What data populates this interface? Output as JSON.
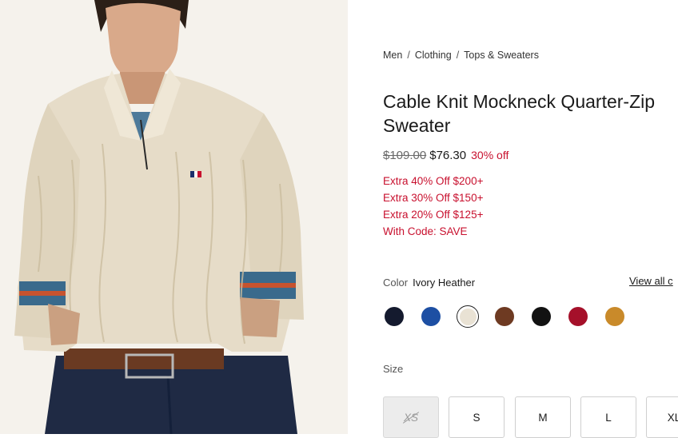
{
  "breadcrumb": [
    {
      "label": "Men"
    },
    {
      "label": "Clothing"
    },
    {
      "label": "Tops & Sweaters"
    }
  ],
  "breadcrumb_separator": "/",
  "product": {
    "title": "Cable Knit Mockneck Quarter-Zip Sweater",
    "original_price": "$109.00",
    "sale_price": "$76.30",
    "discount": "30% off",
    "promos": [
      "Extra 40% Off $200+",
      "Extra 30% Off $150+",
      "Extra 20% Off $125+",
      "With Code: SAVE"
    ]
  },
  "color": {
    "label": "Color",
    "selected": "Ivory Heather",
    "view_all": "View all c",
    "swatches": [
      {
        "name": "navy-swatch",
        "hex": "#141a2e",
        "selected": false
      },
      {
        "name": "royal-blue-swatch",
        "hex": "#1d4fa3",
        "selected": false
      },
      {
        "name": "ivory-heather-swatch",
        "hex": "#e9e2d4",
        "selected": true
      },
      {
        "name": "brown-swatch",
        "hex": "#6e3a22",
        "selected": false
      },
      {
        "name": "black-swatch",
        "hex": "#121212",
        "selected": false
      },
      {
        "name": "red-swatch",
        "hex": "#a5102a",
        "selected": false
      },
      {
        "name": "gold-swatch",
        "hex": "#c98a2a",
        "selected": false
      }
    ]
  },
  "size": {
    "label": "Size",
    "options": [
      {
        "label": "XS",
        "available": false
      },
      {
        "label": "S",
        "available": true
      },
      {
        "label": "M",
        "available": true
      },
      {
        "label": "L",
        "available": true
      },
      {
        "label": "XL",
        "available": true
      }
    ]
  },
  "colors": {
    "sale_red": "#c8102e",
    "text": "#1a1a1a"
  }
}
